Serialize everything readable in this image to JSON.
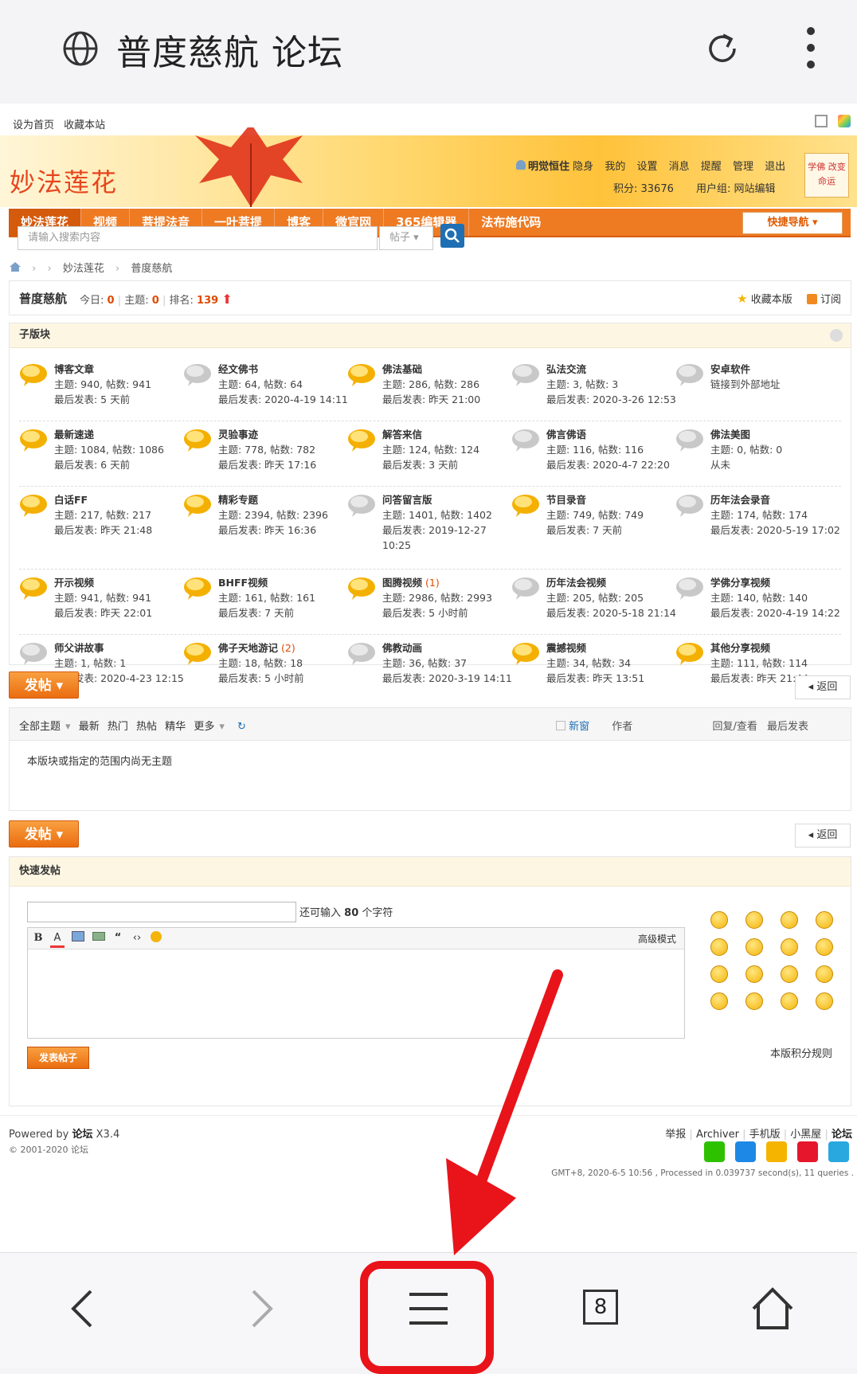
{
  "browser": {
    "title": "普度慈航 论坛"
  },
  "toplinks": [
    "设为首页",
    "收藏本站"
  ],
  "header": {
    "logo": "妙法莲花",
    "user_name": "明觉恒住",
    "user_items": [
      "隐身",
      "我的",
      "设置",
      "消息",
      "提醒",
      "管理",
      "退出"
    ],
    "points": "积分: 33676",
    "group": "用户组: 网站编辑",
    "avatar_text": "学佛 改变命运"
  },
  "nav": {
    "items": [
      "妙法莲花",
      "视频",
      "菩提法音",
      "一叶菩提",
      "博客",
      "微官网",
      "365编辑器",
      "法布施代码"
    ],
    "quick": "快捷导航"
  },
  "search": {
    "placeholder": "请输入搜索内容",
    "type": "帖子"
  },
  "breadcrumb": [
    "妙法莲花",
    "普度慈航"
  ],
  "forum": {
    "name": "普度慈航",
    "today_label": "今日:",
    "today": "0",
    "threads_label": "主题:",
    "threads": "0",
    "rank_label": "排名:",
    "rank": "139",
    "fav": "收藏本版",
    "subscribe": "订阅"
  },
  "subforums": {
    "heading": "子版块",
    "items": [
      {
        "name": "博客文章",
        "new": "",
        "l2": "主题: 940, 帖数: 941",
        "l3": "最后发表: 5 天前",
        "l4": "",
        "active": true
      },
      {
        "name": "经文佛书",
        "new": "",
        "l2": "主题: 64, 帖数: 64",
        "l3": "最后发表: 2020-4-19 14:11",
        "l4": "",
        "active": false
      },
      {
        "name": "佛法基础",
        "new": "",
        "l2": "主题: 286, 帖数: 286",
        "l3": "最后发表: 昨天 21:00",
        "l4": "",
        "active": true
      },
      {
        "name": "弘法交流",
        "new": "",
        "l2": "主题: 3, 帖数: 3",
        "l3": "最后发表: 2020-3-26 12:53",
        "l4": "",
        "active": false
      },
      {
        "name": "安卓软件",
        "new": "",
        "l2": "链接到外部地址",
        "l3": "",
        "l4": "",
        "active": false
      },
      {
        "name": "最新速递",
        "new": "",
        "l2": "主题: 1084, 帖数: 1086",
        "l3": "最后发表: 6 天前",
        "l4": "",
        "active": true
      },
      {
        "name": "灵验事迹",
        "new": "",
        "l2": "主题: 778, 帖数: 782",
        "l3": "最后发表: 昨天 17:16",
        "l4": "",
        "active": true
      },
      {
        "name": "解答来信",
        "new": "",
        "l2": "主题: 124, 帖数: 124",
        "l3": "最后发表: 3 天前",
        "l4": "",
        "active": true
      },
      {
        "name": "佛言佛语",
        "new": "",
        "l2": "主题: 116, 帖数: 116",
        "l3": "最后发表: 2020-4-7 22:20",
        "l4": "",
        "active": false
      },
      {
        "name": "佛法美图",
        "new": "",
        "l2": "主题: 0, 帖数: 0",
        "l3": "从未",
        "l4": "",
        "active": false
      },
      {
        "name": "白话FF",
        "new": "",
        "l2": "主题: 217, 帖数: 217",
        "l3": "最后发表: 昨天 21:48",
        "l4": "",
        "active": true
      },
      {
        "name": "精彩专题",
        "new": "",
        "l2": "主题: 2394, 帖数: 2396",
        "l3": "最后发表: 昨天 16:36",
        "l4": "",
        "active": true
      },
      {
        "name": "问答留言版",
        "new": "",
        "l2": "主题: 1401, 帖数: 1402",
        "l3": "最后发表: 2019-12-27",
        "l4": "10:25",
        "active": false
      },
      {
        "name": "节目录音",
        "new": "",
        "l2": "主题: 749, 帖数: 749",
        "l3": "最后发表: 7 天前",
        "l4": "",
        "active": true
      },
      {
        "name": "历年法会录音",
        "new": "",
        "l2": "主题: 174, 帖数: 174",
        "l3": "最后发表: 2020-5-19 17:02",
        "l4": "",
        "active": false
      },
      {
        "name": "开示视频",
        "new": "",
        "l2": "主题: 941, 帖数: 941",
        "l3": "最后发表: 昨天 22:01",
        "l4": "",
        "active": true
      },
      {
        "name": "BHFF视频",
        "new": "",
        "l2": "主题: 161, 帖数: 161",
        "l3": "最后发表: 7 天前",
        "l4": "",
        "active": true
      },
      {
        "name": "图腾视频",
        "new": "(1)",
        "l2": "主题: 2986, 帖数: 2993",
        "l3": "最后发表: 5 小时前",
        "l4": "",
        "active": true
      },
      {
        "name": "历年法会视频",
        "new": "",
        "l2": "主题: 205, 帖数: 205",
        "l3": "最后发表: 2020-5-18 21:14",
        "l4": "",
        "active": false
      },
      {
        "name": "学佛分享视频",
        "new": "",
        "l2": "主题: 140, 帖数: 140",
        "l3": "最后发表: 2020-4-19 14:22",
        "l4": "",
        "active": false
      },
      {
        "name": "师父讲故事",
        "new": "",
        "l2": "主题: 1, 帖数: 1",
        "l3": "最后发表: 2020-4-23 12:15",
        "l4": "",
        "active": false
      },
      {
        "name": "佛子天地游记",
        "new": "(2)",
        "l2": "主题: 18, 帖数: 18",
        "l3": "最后发表: 5 小时前",
        "l4": "",
        "active": true
      },
      {
        "name": "佛教动画",
        "new": "",
        "l2": "主题: 36, 帖数: 37",
        "l3": "最后发表: 2020-3-19 14:11",
        "l4": "",
        "active": false
      },
      {
        "name": "震撼视频",
        "new": "",
        "l2": "主题: 34, 帖数: 34",
        "l3": "最后发表: 昨天 13:51",
        "l4": "",
        "active": true
      },
      {
        "name": "其他分享视频",
        "new": "",
        "l2": "主题: 111, 帖数: 114",
        "l3": "最后发表: 昨天 21:44",
        "l4": "",
        "active": true
      }
    ]
  },
  "actions": {
    "post": "发帖",
    "back": "返回"
  },
  "threads": {
    "filters": [
      "全部主题",
      "最新",
      "热门",
      "热帖",
      "精华",
      "更多"
    ],
    "newwin": "新窗",
    "author": "作者",
    "replies": "回复/查看",
    "last": "最后发表",
    "empty": "本版块或指定的范围内尚无主题"
  },
  "quickpost": {
    "heading": "快速发帖",
    "remain_prefix": "还可输入",
    "remain": "80",
    "remain_suffix": "个字符",
    "adv": "高级模式",
    "submit": "发表帖子",
    "rules": "本版积分规则"
  },
  "footer": {
    "powered_prefix": "Powered by",
    "powered_name": "论坛",
    "powered_ver": "X3.4",
    "copy": "© 2001-2020 论坛",
    "links": [
      "举报",
      "Archiver",
      "手机版",
      "小黑屋"
    ],
    "links_bold": "论坛",
    "gmt": "GMT+8, 2020-6-5 10:56 , Processed in 0.039737 second(s), 11 queries ."
  },
  "bottom": {
    "tabs": "8"
  },
  "colors": {
    "nav": "#ee7a22",
    "accent": "#e04a00",
    "highlight": "#e8141a"
  }
}
